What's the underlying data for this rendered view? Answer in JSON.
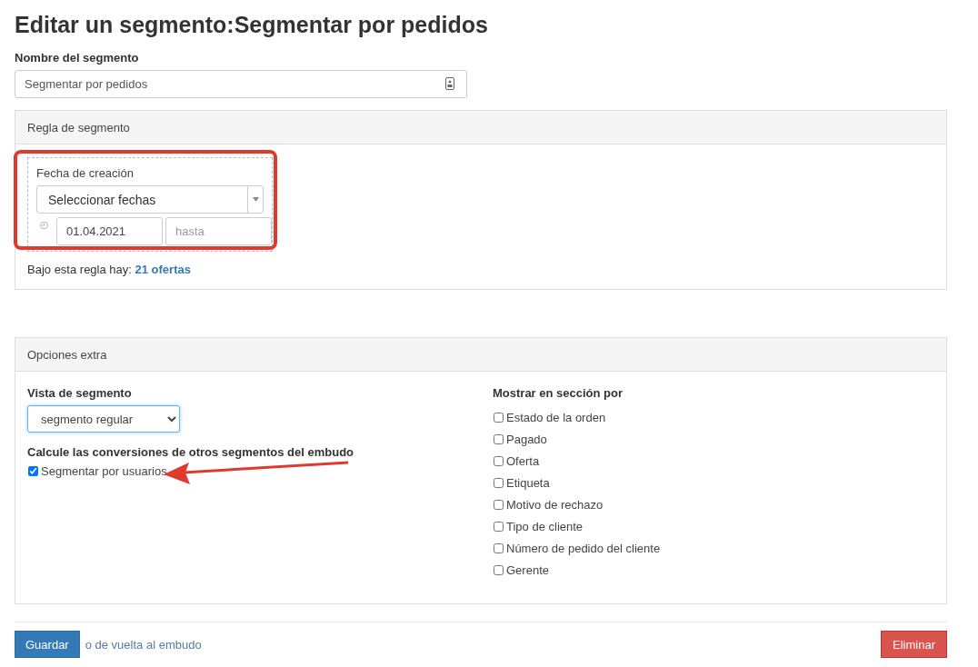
{
  "title": "Editar un segmento:Segmentar por pedidos",
  "name_field": {
    "label": "Nombre del segmento",
    "value": "Segmentar por pedidos"
  },
  "rule_panel": {
    "heading": "Regla de segmento",
    "rule": {
      "label": "Fecha de creación",
      "select_value": "Seleccionar fechas",
      "date_from": "01.04.2021",
      "date_to_placeholder": "hasta"
    },
    "summary": {
      "text": "Bajo esta regla hay:",
      "count_link": "21 ofertas"
    }
  },
  "extra_panel": {
    "heading": "Opciones extra",
    "view": {
      "label": "Vista de segmento",
      "value": "segmento regular"
    },
    "conversions": {
      "label": "Calcule las conversiones de otros segmentos del embudo",
      "checkbox": {
        "label": "Segmentar por usuarios",
        "checked": true
      }
    },
    "show_by": {
      "label": "Mostrar en sección por",
      "options": [
        {
          "label": "Estado de la orden",
          "checked": false
        },
        {
          "label": "Pagado",
          "checked": false
        },
        {
          "label": "Oferta",
          "checked": false
        },
        {
          "label": "Etiqueta",
          "checked": false
        },
        {
          "label": "Motivo de rechazo",
          "checked": false
        },
        {
          "label": "Tipo de cliente",
          "checked": false
        },
        {
          "label": "Número de pedido del cliente",
          "checked": false
        },
        {
          "label": "Gerente",
          "checked": false
        }
      ]
    }
  },
  "actions": {
    "save": "Guardar",
    "back_link": "o de vuelta al embudo",
    "delete": "Eliminar"
  }
}
